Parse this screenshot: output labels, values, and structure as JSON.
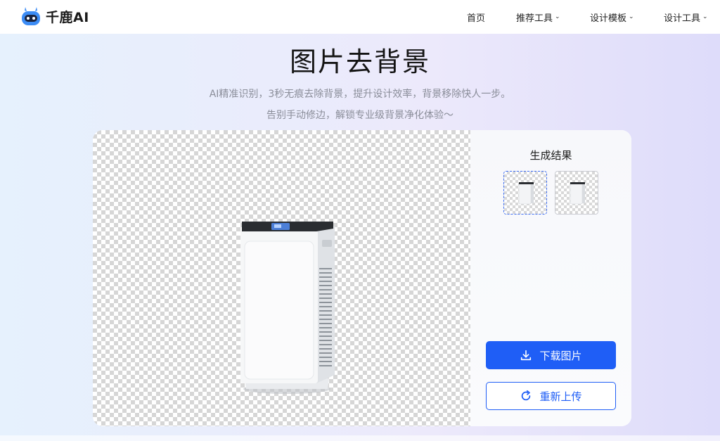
{
  "brand": {
    "name": "千鹿AI"
  },
  "nav": {
    "home": "首页",
    "recommended": "推荐工具",
    "templates": "设计模板",
    "design_tools": "设计工具",
    "caret": "⌄"
  },
  "hero": {
    "title": "图片去背景",
    "subtitle_1": "AI精准识别，3秒无痕去除背景，提升设计效率，背景移除快人一步。",
    "subtitle_2": "告别手动修边，解锁专业级背景净化体验～"
  },
  "result_panel": {
    "title": "生成结果",
    "download_label": "下载图片",
    "reupload_label": "重新上传"
  },
  "colors": {
    "accent": "#1f5ef6",
    "brand_blue": "#3c8cf5"
  },
  "icons": [
    "logo-deer-icon",
    "download-icon",
    "refresh-icon",
    "chevron-down-icon"
  ]
}
